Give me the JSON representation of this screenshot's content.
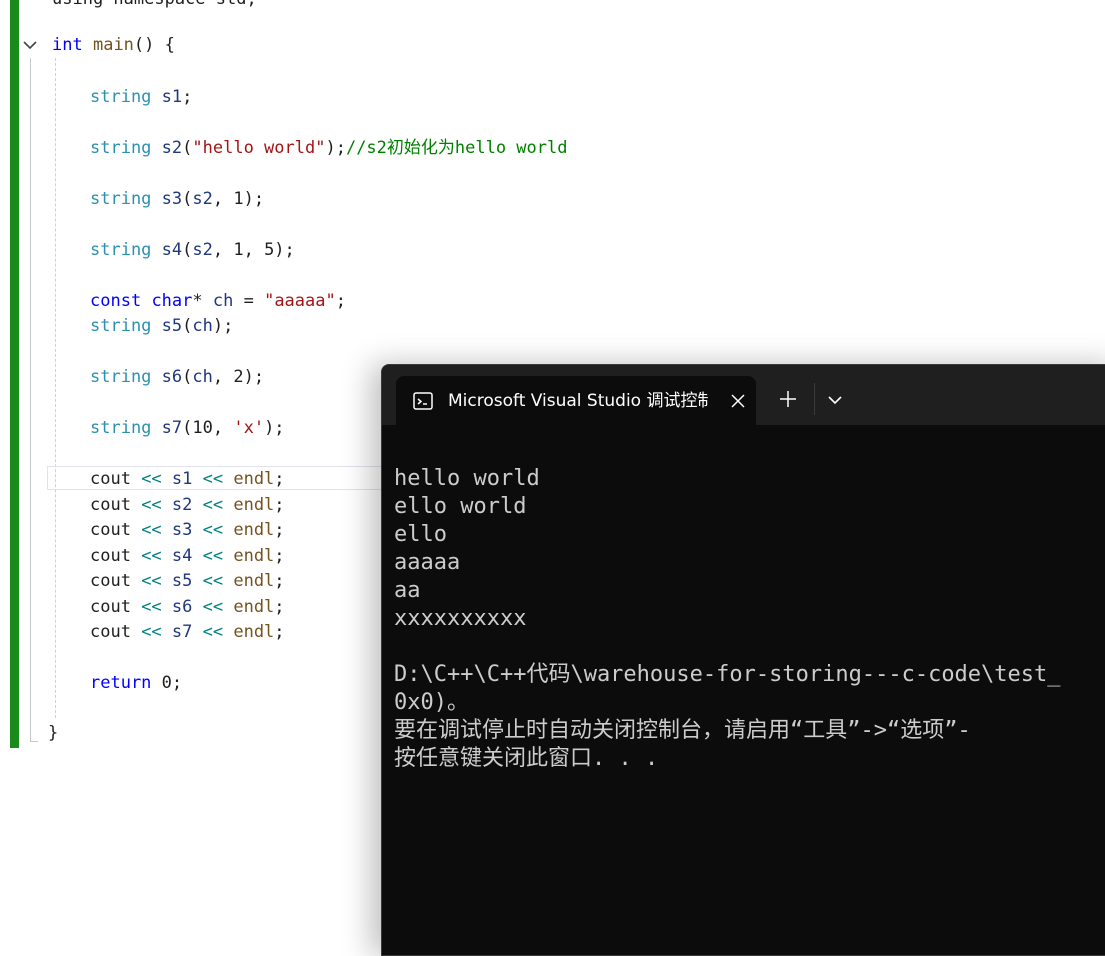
{
  "editor": {
    "top_partial": "using namespace std;",
    "lines": [
      [
        {
          "t": "int",
          "c": "kw"
        },
        {
          "t": " ",
          "c": "pl"
        },
        {
          "t": "main",
          "c": "fn"
        },
        {
          "t": "() {",
          "c": "pl"
        }
      ],
      [
        {
          "t": "string",
          "c": "ty"
        },
        {
          "t": " ",
          "c": "pl"
        },
        {
          "t": "s1",
          "c": "var"
        },
        {
          "t": ";",
          "c": "pl"
        }
      ],
      [
        {
          "t": "string",
          "c": "ty"
        },
        {
          "t": " ",
          "c": "pl"
        },
        {
          "t": "s2",
          "c": "var"
        },
        {
          "t": "(",
          "c": "pl"
        },
        {
          "t": "\"hello world\"",
          "c": "str"
        },
        {
          "t": ");",
          "c": "pl"
        },
        {
          "t": "//s2初始化为hello world",
          "c": "cm"
        }
      ],
      [
        {
          "t": "string",
          "c": "ty"
        },
        {
          "t": " ",
          "c": "pl"
        },
        {
          "t": "s3",
          "c": "var"
        },
        {
          "t": "(",
          "c": "pl"
        },
        {
          "t": "s2",
          "c": "var"
        },
        {
          "t": ", 1);",
          "c": "pl"
        }
      ],
      [
        {
          "t": "string",
          "c": "ty"
        },
        {
          "t": " ",
          "c": "pl"
        },
        {
          "t": "s4",
          "c": "var"
        },
        {
          "t": "(",
          "c": "pl"
        },
        {
          "t": "s2",
          "c": "var"
        },
        {
          "t": ", 1, 5);",
          "c": "pl"
        }
      ],
      [
        {
          "t": "const",
          "c": "kw"
        },
        {
          "t": " ",
          "c": "pl"
        },
        {
          "t": "char",
          "c": "kw"
        },
        {
          "t": "* ",
          "c": "pl"
        },
        {
          "t": "ch",
          "c": "var"
        },
        {
          "t": " = ",
          "c": "pl"
        },
        {
          "t": "\"aaaaa\"",
          "c": "str"
        },
        {
          "t": ";",
          "c": "pl"
        }
      ],
      [
        {
          "t": "string",
          "c": "ty"
        },
        {
          "t": " ",
          "c": "pl"
        },
        {
          "t": "s5",
          "c": "var"
        },
        {
          "t": "(",
          "c": "pl"
        },
        {
          "t": "ch",
          "c": "var"
        },
        {
          "t": ");",
          "c": "pl"
        }
      ],
      [
        {
          "t": "string",
          "c": "ty"
        },
        {
          "t": " ",
          "c": "pl"
        },
        {
          "t": "s6",
          "c": "var"
        },
        {
          "t": "(",
          "c": "pl"
        },
        {
          "t": "ch",
          "c": "var"
        },
        {
          "t": ", 2);",
          "c": "pl"
        }
      ],
      [
        {
          "t": "string",
          "c": "ty"
        },
        {
          "t": " ",
          "c": "pl"
        },
        {
          "t": "s7",
          "c": "var"
        },
        {
          "t": "(10, ",
          "c": "pl"
        },
        {
          "t": "'x'",
          "c": "str"
        },
        {
          "t": ");",
          "c": "pl"
        }
      ],
      [
        {
          "t": "cout",
          "c": "pl"
        },
        {
          "t": " << ",
          "c": "op"
        },
        {
          "t": "s1",
          "c": "var"
        },
        {
          "t": " << ",
          "c": "op"
        },
        {
          "t": "endl",
          "c": "fn"
        },
        {
          "t": ";",
          "c": "pl"
        }
      ],
      [
        {
          "t": "cout",
          "c": "pl"
        },
        {
          "t": " << ",
          "c": "op"
        },
        {
          "t": "s2",
          "c": "var"
        },
        {
          "t": " << ",
          "c": "op"
        },
        {
          "t": "endl",
          "c": "fn"
        },
        {
          "t": ";",
          "c": "pl"
        }
      ],
      [
        {
          "t": "cout",
          "c": "pl"
        },
        {
          "t": " << ",
          "c": "op"
        },
        {
          "t": "s3",
          "c": "var"
        },
        {
          "t": " << ",
          "c": "op"
        },
        {
          "t": "endl",
          "c": "fn"
        },
        {
          "t": ";",
          "c": "pl"
        }
      ],
      [
        {
          "t": "cout",
          "c": "pl"
        },
        {
          "t": " << ",
          "c": "op"
        },
        {
          "t": "s4",
          "c": "var"
        },
        {
          "t": " << ",
          "c": "op"
        },
        {
          "t": "endl",
          "c": "fn"
        },
        {
          "t": ";",
          "c": "pl"
        }
      ],
      [
        {
          "t": "cout",
          "c": "pl"
        },
        {
          "t": " << ",
          "c": "op"
        },
        {
          "t": "s5",
          "c": "var"
        },
        {
          "t": " << ",
          "c": "op"
        },
        {
          "t": "endl",
          "c": "fn"
        },
        {
          "t": ";",
          "c": "pl"
        }
      ],
      [
        {
          "t": "cout",
          "c": "pl"
        },
        {
          "t": " << ",
          "c": "op"
        },
        {
          "t": "s6",
          "c": "var"
        },
        {
          "t": " << ",
          "c": "op"
        },
        {
          "t": "endl",
          "c": "fn"
        },
        {
          "t": ";",
          "c": "pl"
        }
      ],
      [
        {
          "t": "cout",
          "c": "pl"
        },
        {
          "t": " << ",
          "c": "op"
        },
        {
          "t": "s7",
          "c": "var"
        },
        {
          "t": " << ",
          "c": "op"
        },
        {
          "t": "endl",
          "c": "fn"
        },
        {
          "t": ";",
          "c": "pl"
        }
      ],
      [
        {
          "t": "return",
          "c": "kw"
        },
        {
          "t": " 0;",
          "c": "pl"
        }
      ],
      [
        {
          "t": "}",
          "c": "pl"
        }
      ]
    ]
  },
  "terminal": {
    "tab_title": "Microsoft Visual Studio 调试控制台",
    "output_lines": [
      "hello world",
      "ello world",
      "ello",
      "aaaaa",
      "aa",
      "xxxxxxxxxx",
      "",
      "D:\\C++\\C++代码\\warehouse-for-storing---c-code\\test_",
      "0x0)。",
      "要在调试停止时自动关闭控制台，请启用“工具”->“选项”-",
      "按任意键关闭此窗口. . ."
    ]
  },
  "colors": {
    "change_bar": "#1a8a1a",
    "keyword": "#0000ff",
    "type": "#2b91af",
    "function": "#74531f",
    "string": "#a31515",
    "comment": "#008000",
    "terminal_bg": "#0c0c0c",
    "terminal_text": "#cccccc"
  }
}
